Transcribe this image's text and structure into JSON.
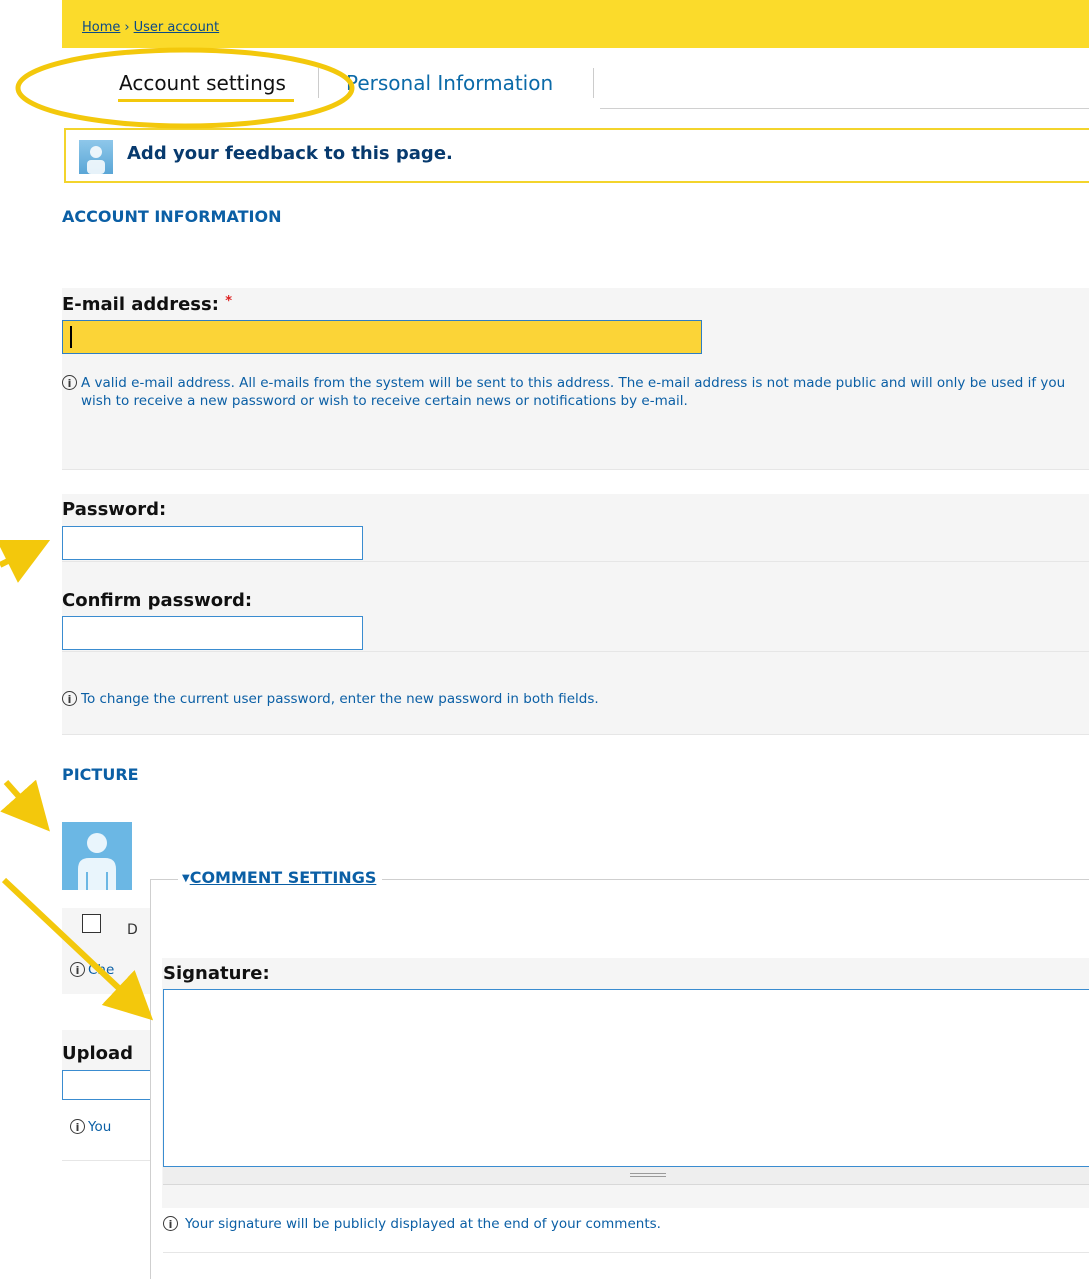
{
  "breadcrumb": {
    "home": "Home",
    "separator": "›",
    "current": "User account"
  },
  "tabs": [
    {
      "label": "Account settings"
    },
    {
      "label": "Personal Information"
    }
  ],
  "feedback": {
    "text": "Add your feedback to this page."
  },
  "account_info": {
    "title": "ACCOUNT INFORMATION",
    "email": {
      "label": "E-mail address:",
      "required_mark": "*",
      "value": "",
      "description": "A valid e-mail address. All e-mails from the system will be sent to this address. The e-mail address is not made public and will only be used if you wish to receive a new password or wish to receive certain news or notifications by e-mail."
    },
    "password": {
      "label": "Password:",
      "value": ""
    },
    "confirm_password": {
      "label": "Confirm password:",
      "value": ""
    },
    "password_description": "To change the current user password, enter the new password in both fields."
  },
  "picture": {
    "title": "PICTURE",
    "checkbox_label_partial": "D",
    "help_partial": "Che",
    "upload_label_partial": "Upload",
    "upload_help_partial": "You"
  },
  "comment_settings": {
    "legend": "COMMENT SETTINGS",
    "signature_label": "Signature:",
    "signature_value": "",
    "signature_description": "Your signature will be publicly displayed at the end of your comments."
  },
  "colors": {
    "accent_yellow": "#fbdb2b",
    "link_blue": "#0b5fa5",
    "annotation_yellow": "#f3c80c"
  }
}
